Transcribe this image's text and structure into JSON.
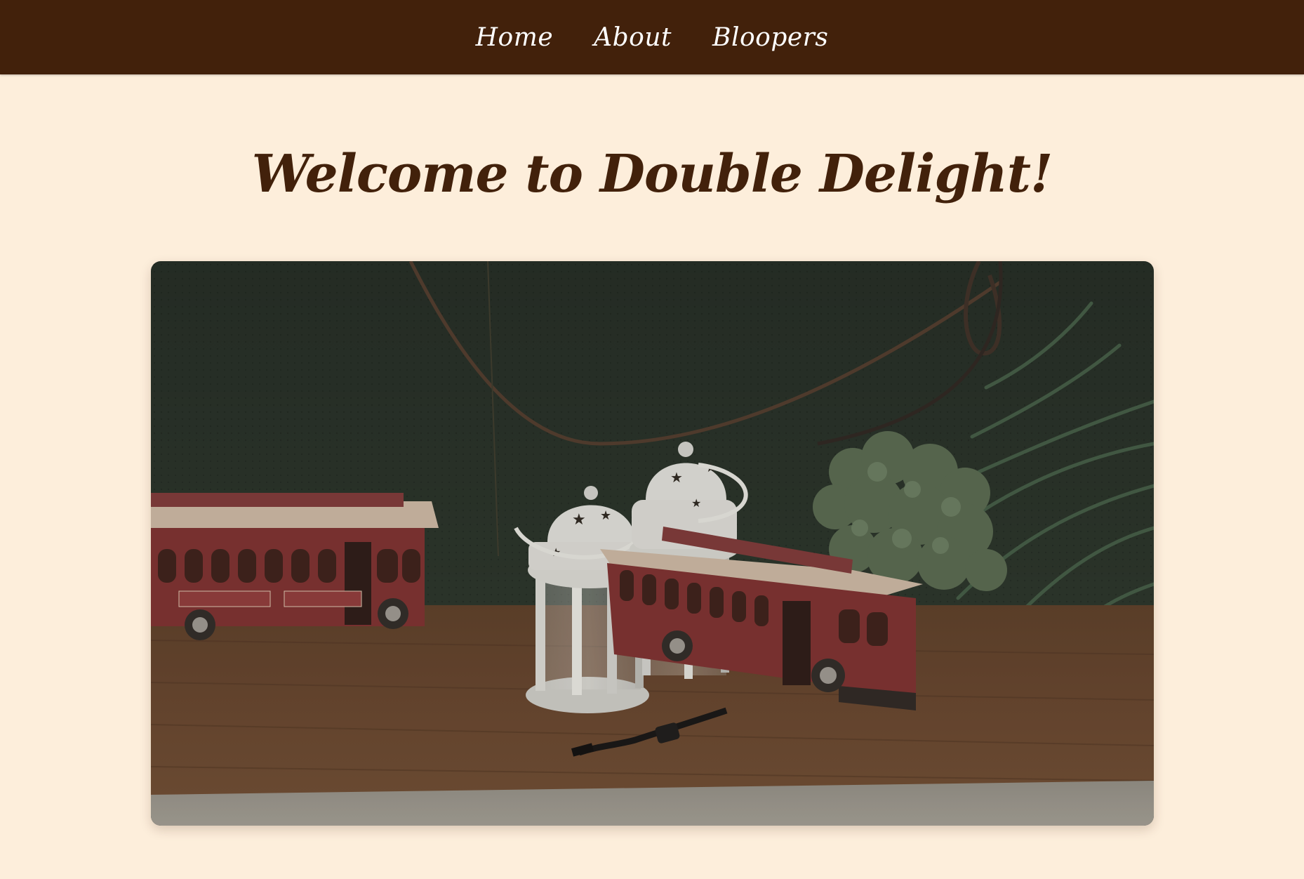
{
  "nav": {
    "items": [
      {
        "label": "Home"
      },
      {
        "label": "About"
      },
      {
        "label": "Bloopers"
      }
    ]
  },
  "main": {
    "title": "Welcome to Double Delight!"
  },
  "colors": {
    "navbar_bg": "#42210b",
    "page_bg": "#fdeedb",
    "title_text": "#42210b",
    "nav_text": "#ffffff"
  }
}
